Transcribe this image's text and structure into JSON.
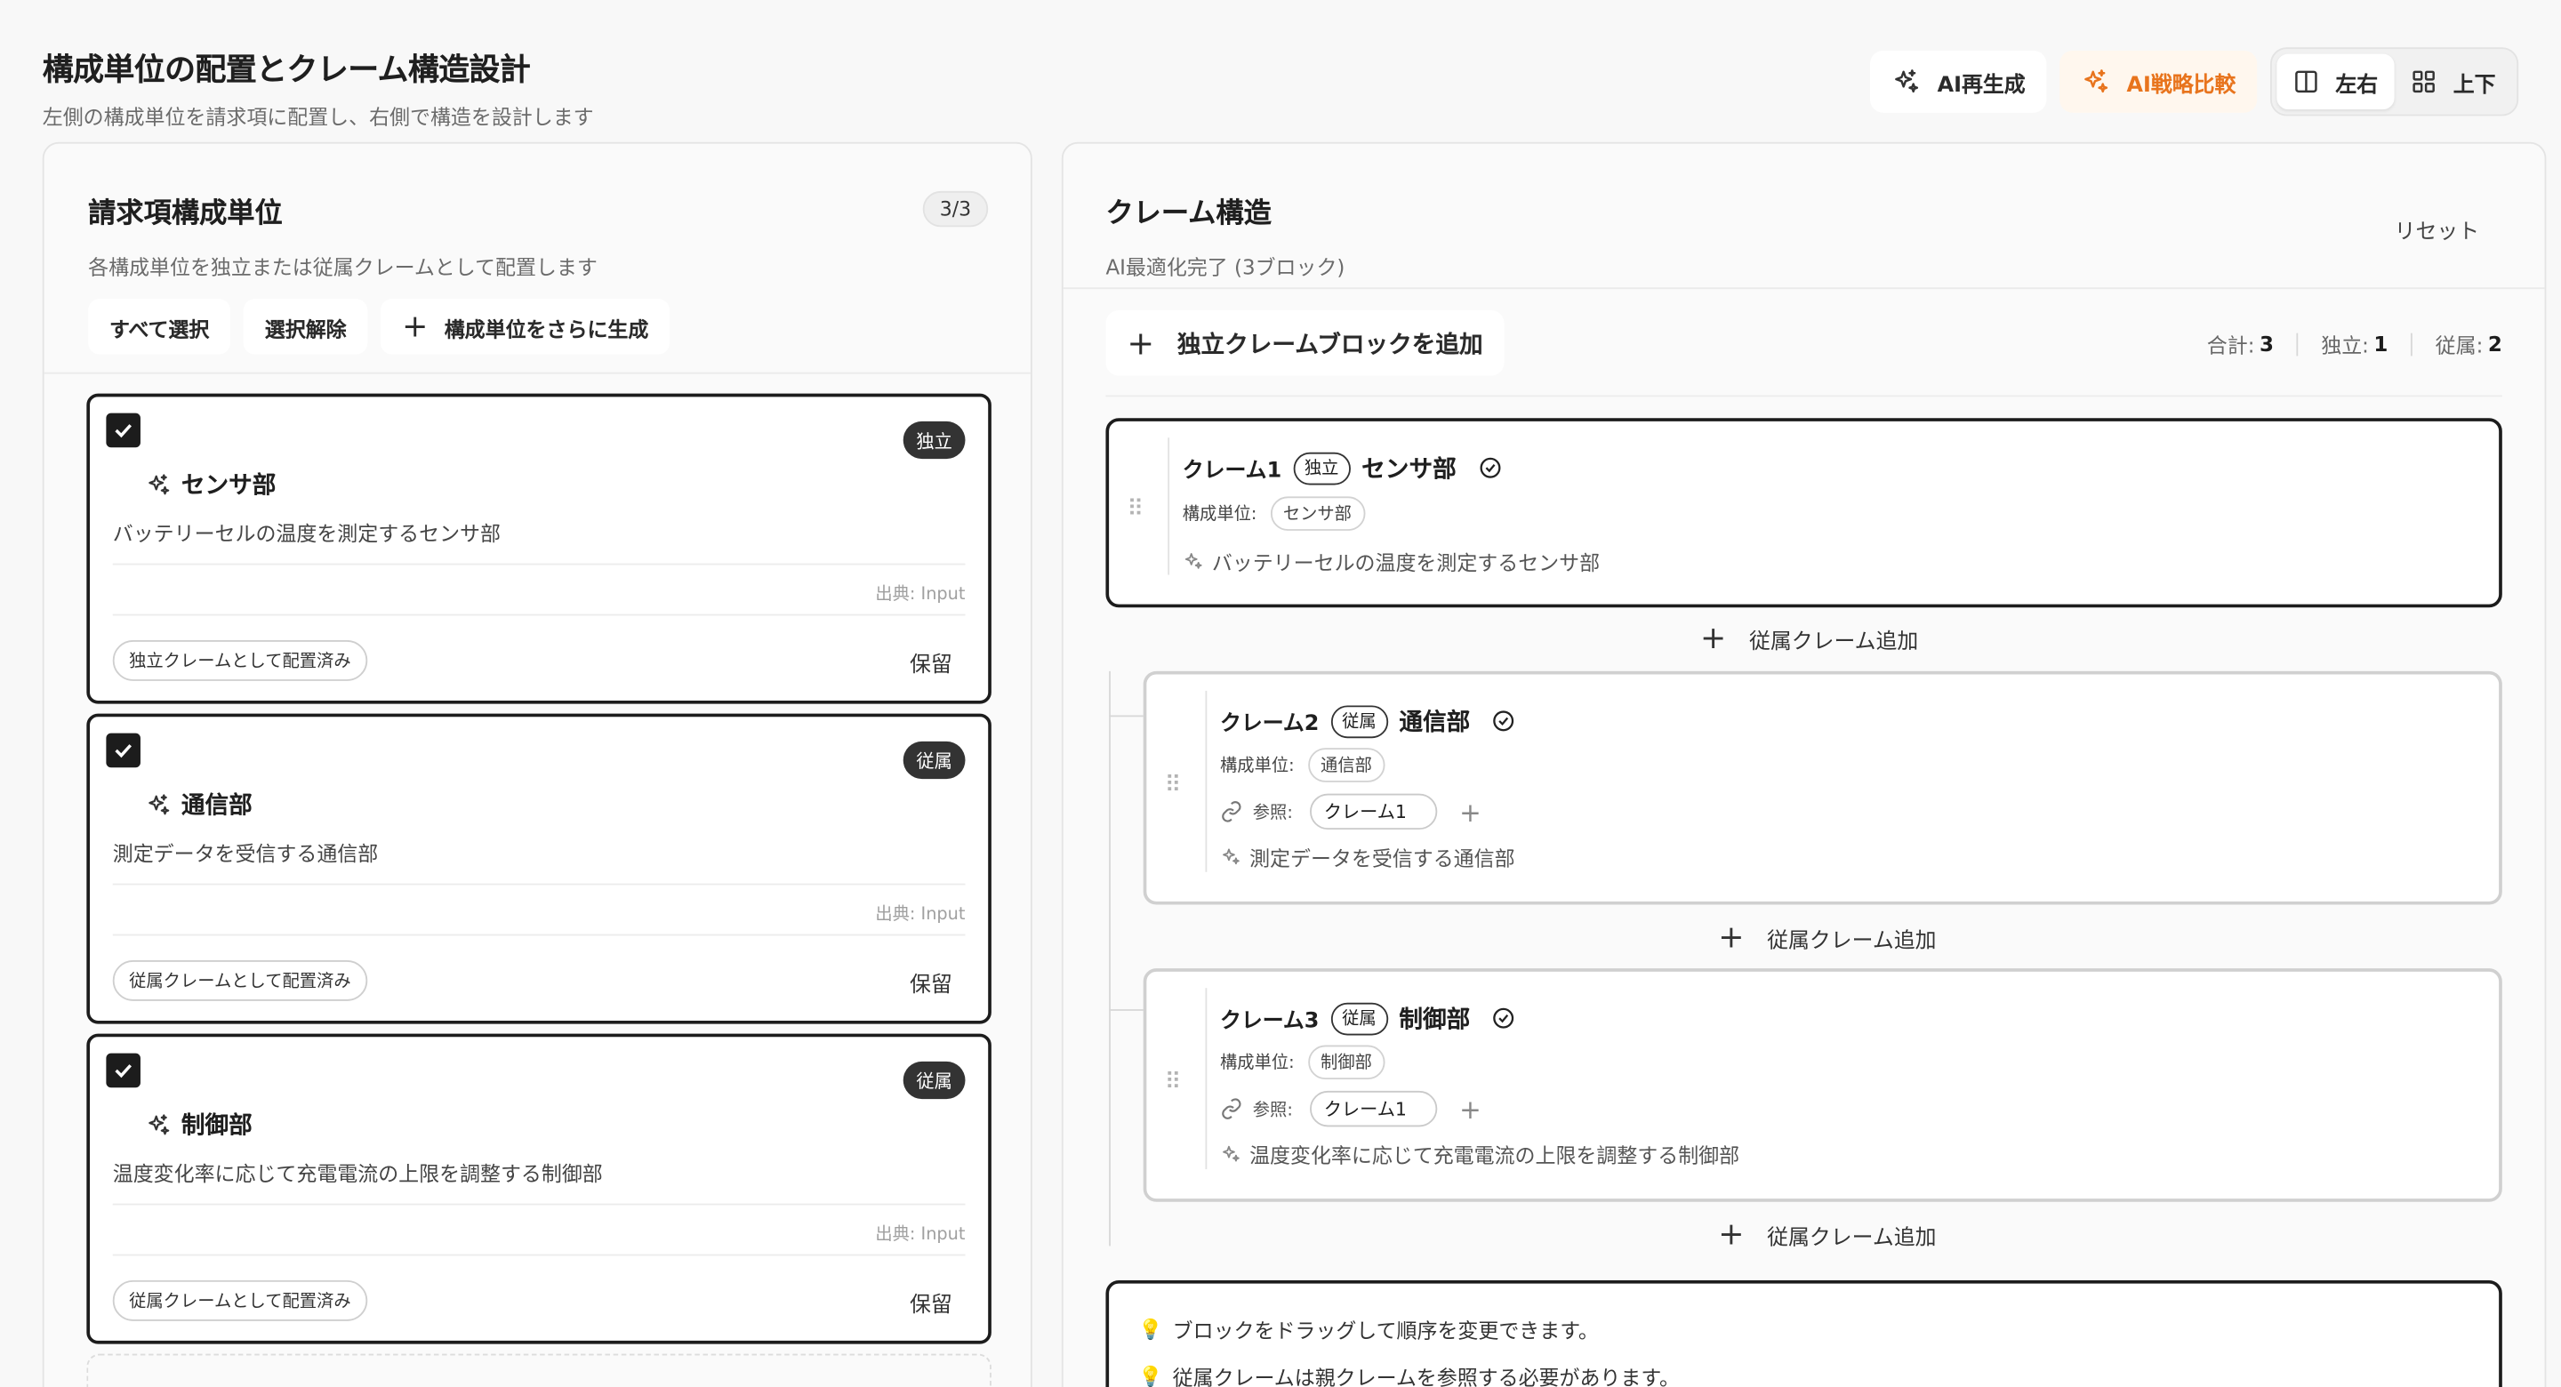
{
  "header": {
    "title": "構成単位の配置とクレーム構造設計",
    "subtitle": "左側の構成単位を請求項に配置し、右側で構造を設計します"
  },
  "toolbar": {
    "regenerate": "AI再生成",
    "compare": "AI戦略比較",
    "layout_lr": "左右",
    "layout_tb": "上下",
    "accent": "#e8741d"
  },
  "left": {
    "title": "請求項構成単位",
    "subtitle": "各構成単位を独立または従属クレームとして配置します",
    "count": "3/3",
    "select_all": "すべて選択",
    "deselect": "選択解除",
    "generate_more": "構成単位をさらに生成",
    "units": [
      {
        "name": "センサ部",
        "type": "独立",
        "desc": "バッテリーセルの温度を測定するセンサ部",
        "source": "出典: Input",
        "status": "独立クレームとして配置済み",
        "hold": "保留"
      },
      {
        "name": "通信部",
        "type": "従属",
        "desc": "測定データを受信する通信部",
        "source": "出典: Input",
        "status": "従属クレームとして配置済み",
        "hold": "保留"
      },
      {
        "name": "制御部",
        "type": "従属",
        "desc": "温度変化率に応じて充電電流の上限を調整する制御部",
        "source": "出典: Input",
        "status": "従属クレームとして配置済み",
        "hold": "保留"
      }
    ]
  },
  "right": {
    "title": "クレーム構造",
    "subtitle": "AI最適化完了 (3ブロック)",
    "reset": "リセット",
    "add_block": "独立クレームブロックを追加",
    "stats": {
      "total_label": "合計:",
      "total": "3",
      "ind_label": "独立:",
      "ind": "1",
      "dep_label": "従属:",
      "dep": "2"
    },
    "units_label": "構成単位:",
    "ref_label": "参照:",
    "add_dep": "従属クレーム追加",
    "claims": [
      {
        "num": "クレーム1",
        "type": "独立",
        "name": "センサ部",
        "unit": "センサ部",
        "desc": "バッテリーセルの温度を測定するセンサ部"
      },
      {
        "num": "クレーム2",
        "type": "従属",
        "name": "通信部",
        "unit": "通信部",
        "ref": "クレーム1",
        "desc": "測定データを受信する通信部"
      },
      {
        "num": "クレーム3",
        "type": "従属",
        "name": "制御部",
        "unit": "制御部",
        "ref": "クレーム1",
        "desc": "温度変化率に応じて充電電流の上限を調整する制御部"
      }
    ],
    "tips": [
      "ブロックをドラッグして順序を変更できます。",
      "従属クレームは親クレームを参照する必要があります。"
    ]
  }
}
